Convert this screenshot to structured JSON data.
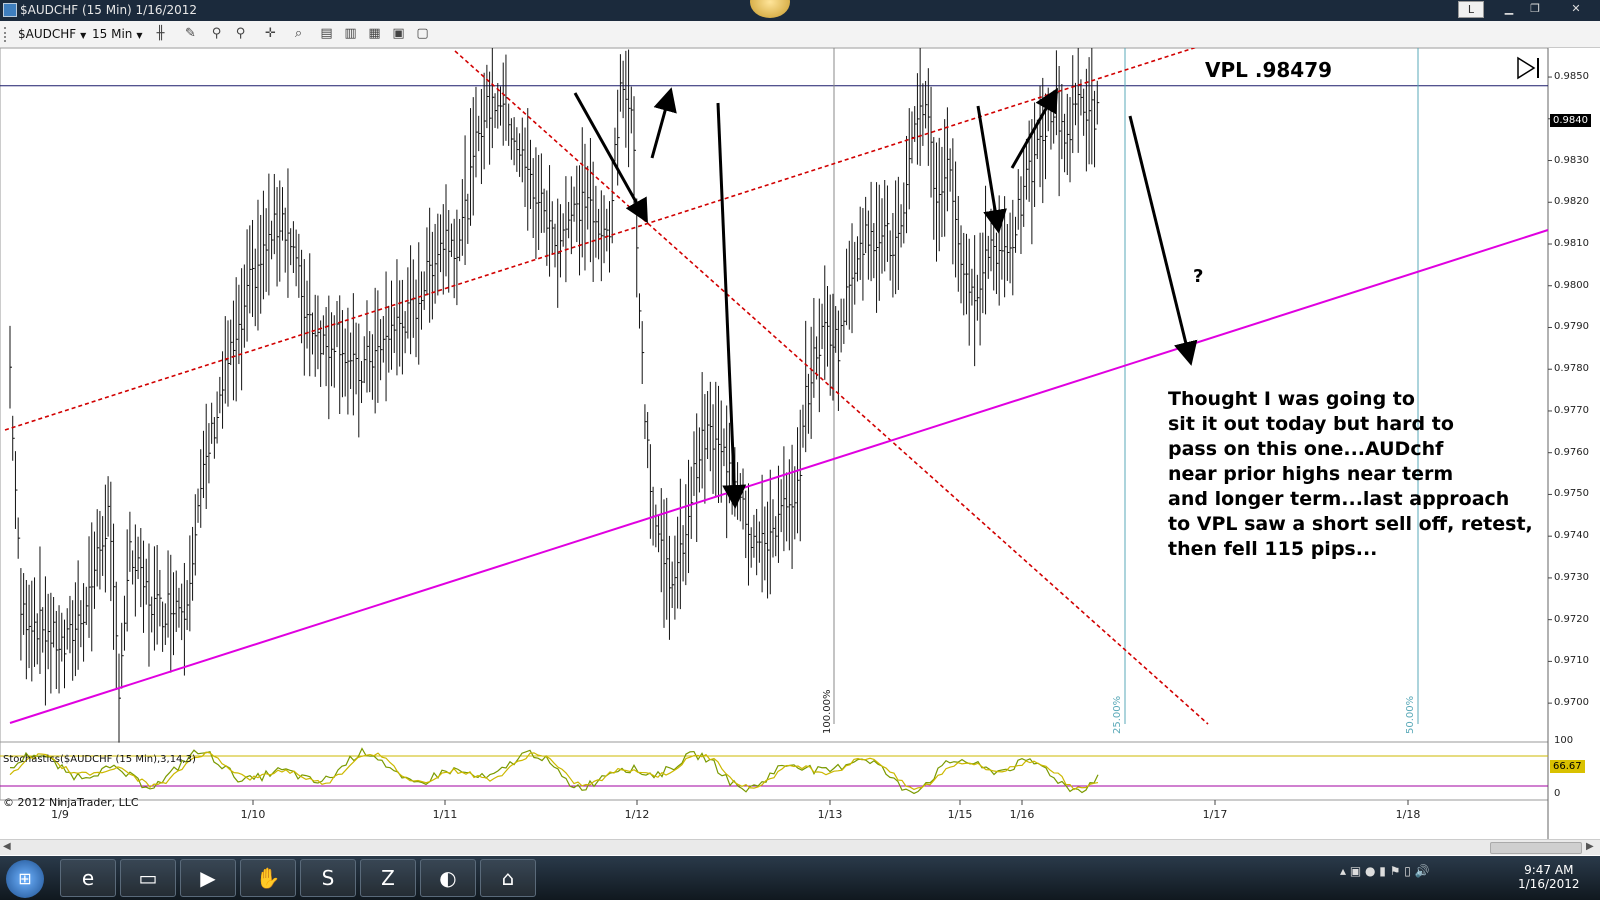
{
  "window": {
    "title": "$AUDCHF (15 Min)  1/16/2012",
    "layout_button": "L"
  },
  "toolbar": {
    "instrument": "$AUDCHF",
    "interval": "15 Min"
  },
  "chart": {
    "annotation_vpl": "VPL  .98479",
    "question": "?",
    "note_lines": [
      "Thought I was going to",
      "sit it out today but hard to",
      "pass on this one...AUDchf",
      "near prior highs near term",
      "and longer term...last approach",
      "to VPL saw a short sell off, retest,",
      "then fell 115 pips..."
    ],
    "last_price": "0.9840",
    "fib_labels": [
      "100.00%",
      "25.00%",
      "50.00%"
    ],
    "stochastics_title": "Stochastics($AUDCHF (15 Min),3,14,3)",
    "stochastics_value": "66.67",
    "stoch_scale_top": "100",
    "stoch_scale_bottom": "0",
    "copyright": "© 2012 NinjaTrader, LLC",
    "colors": {
      "bars": "#111111",
      "resistance_dashed": "#d10000",
      "support_line": "#e000e0",
      "vpl_line": "#1a1a6a",
      "fib_line": "#5aa9b8",
      "stoch_k": "#7a9a00",
      "stoch_d": "#ccb800"
    }
  },
  "chart_data": {
    "type": "candlestick",
    "title": "$AUDCHF (15 Min)  1/16/2012",
    "x_ticks": [
      "1/9",
      "1/10",
      "1/11",
      "1/12",
      "1/13",
      "1/15",
      "1/16",
      "1/17",
      "1/18"
    ],
    "y_ticks": [
      "0.9850",
      "0.9840",
      "0.9830",
      "0.9820",
      "0.9810",
      "0.9800",
      "0.9790",
      "0.9780",
      "0.9770",
      "0.9760",
      "0.9750",
      "0.9740",
      "0.9730",
      "0.9720",
      "0.9710",
      "0.9700"
    ],
    "ylim": [
      0.9695,
      0.9856
    ],
    "vpl_level": 0.98479,
    "last_price": 0.984,
    "price_path": [
      [
        0,
        0.978
      ],
      [
        1,
        0.9722
      ],
      [
        3,
        0.9718
      ],
      [
        5,
        0.9713
      ],
      [
        7,
        0.9724
      ],
      [
        9,
        0.9745
      ],
      [
        10,
        0.9705
      ],
      [
        11,
        0.9735
      ],
      [
        13,
        0.9724
      ],
      [
        14,
        0.9722
      ],
      [
        15,
        0.9725
      ],
      [
        16,
        0.9723
      ],
      [
        17,
        0.9741
      ],
      [
        18,
        0.9758
      ],
      [
        19,
        0.977
      ],
      [
        20,
        0.9782
      ],
      [
        21,
        0.9787
      ],
      [
        22,
        0.98
      ],
      [
        24,
        0.9812
      ],
      [
        25,
        0.9817
      ],
      [
        26,
        0.9808
      ],
      [
        27,
        0.9795
      ],
      [
        28,
        0.979
      ],
      [
        29,
        0.9785
      ],
      [
        30,
        0.9789
      ],
      [
        31,
        0.9782
      ],
      [
        32,
        0.9778
      ],
      [
        33,
        0.9783
      ],
      [
        34,
        0.9784
      ],
      [
        35,
        0.979
      ],
      [
        36,
        0.9791
      ],
      [
        37,
        0.9794
      ],
      [
        38,
        0.98
      ],
      [
        39,
        0.9808
      ],
      [
        40,
        0.9812
      ],
      [
        41,
        0.981
      ],
      [
        42,
        0.982
      ],
      [
        43,
        0.9838
      ],
      [
        44,
        0.9843
      ],
      [
        45,
        0.9845
      ],
      [
        46,
        0.9838
      ],
      [
        47,
        0.983
      ],
      [
        48,
        0.9823
      ],
      [
        49,
        0.9818
      ],
      [
        50,
        0.981
      ],
      [
        51,
        0.9815
      ],
      [
        52,
        0.9818
      ],
      [
        53,
        0.9822
      ],
      [
        54,
        0.981
      ],
      [
        55,
        0.9815
      ],
      [
        56,
        0.9845
      ],
      [
        57,
        0.9846
      ],
      [
        58,
        0.978
      ],
      [
        59,
        0.9745
      ],
      [
        60,
        0.9735
      ],
      [
        61,
        0.9728
      ],
      [
        62,
        0.9742
      ],
      [
        63,
        0.9758
      ],
      [
        64,
        0.9765
      ],
      [
        65,
        0.976
      ],
      [
        66,
        0.9758
      ],
      [
        67,
        0.9752
      ],
      [
        68,
        0.974
      ],
      [
        69,
        0.9737
      ],
      [
        70,
        0.9742
      ],
      [
        71,
        0.9746
      ],
      [
        72,
        0.9745
      ],
      [
        73,
        0.9772
      ],
      [
        74,
        0.9785
      ],
      [
        75,
        0.979
      ],
      [
        76,
        0.9786
      ],
      [
        77,
        0.98
      ],
      [
        78,
        0.9812
      ],
      [
        79,
        0.981
      ],
      [
        80,
        0.9815
      ],
      [
        81,
        0.9808
      ],
      [
        82,
        0.9814
      ],
      [
        83,
        0.984
      ],
      [
        84,
        0.9845
      ],
      [
        85,
        0.982
      ],
      [
        86,
        0.983
      ],
      [
        87,
        0.9812
      ],
      [
        88,
        0.9795
      ],
      [
        89,
        0.9803
      ],
      [
        90,
        0.981
      ],
      [
        91,
        0.9808
      ],
      [
        92,
        0.9812
      ],
      [
        93,
        0.9822
      ],
      [
        94,
        0.983
      ],
      [
        95,
        0.9838
      ],
      [
        96,
        0.9843
      ],
      [
        97,
        0.9835
      ],
      [
        98,
        0.9845
      ],
      [
        99,
        0.9842
      ],
      [
        100,
        0.984
      ]
    ],
    "stochastics": {
      "params": "3,14,3",
      "upper_band": 80,
      "lower_band": 20,
      "last_value": 66.67
    }
  },
  "taskbar": {
    "clock_time": "9:47 AM",
    "clock_date": "1/16/2012"
  }
}
